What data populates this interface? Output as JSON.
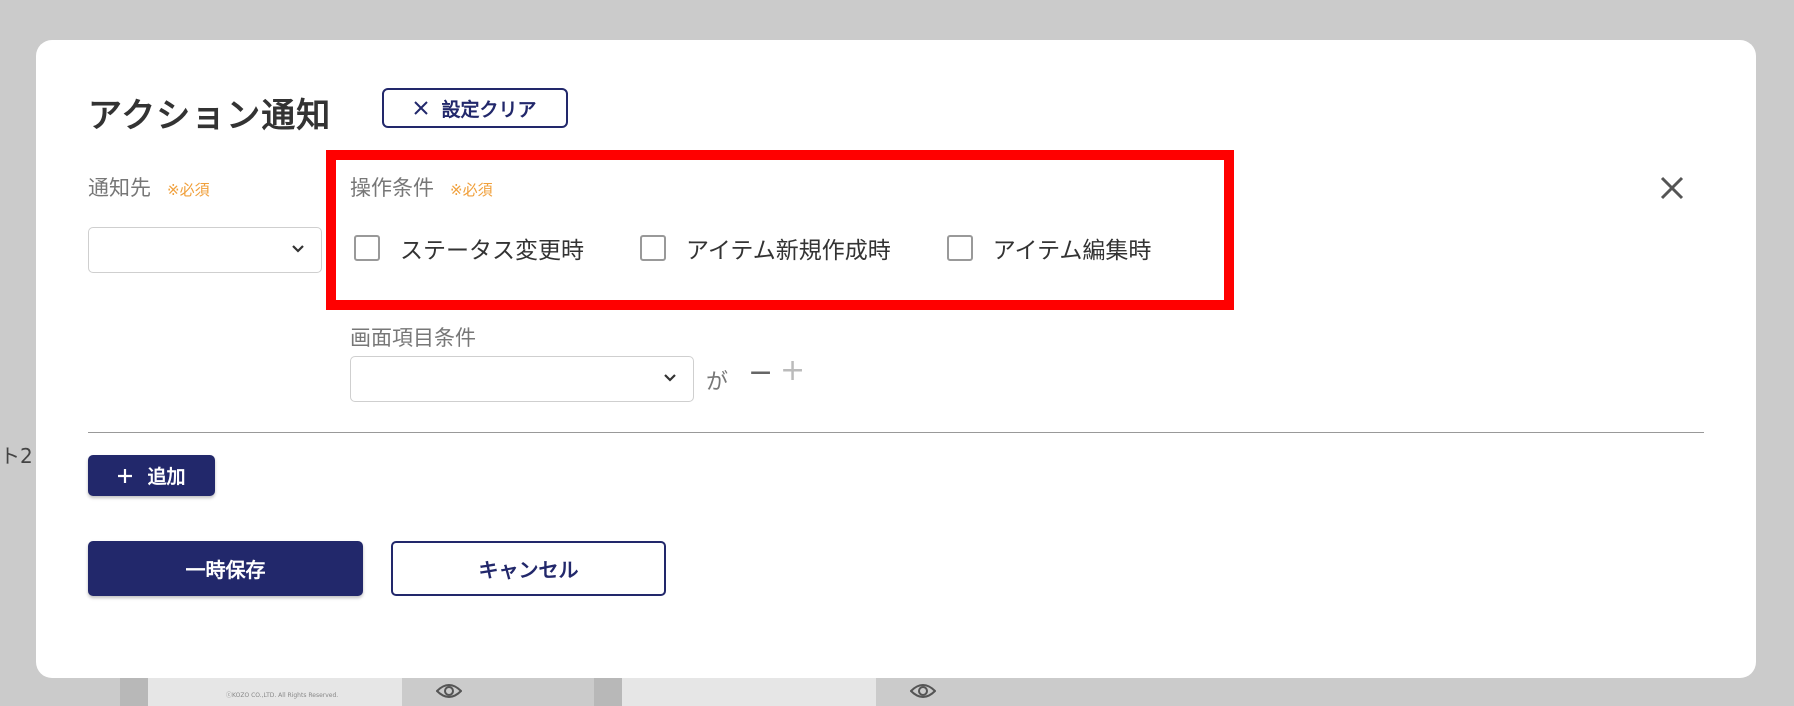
{
  "background": {
    "side_text": "ト2",
    "thumb_caption_1": "ⓒKOZO CO.,LTD. All Rights Reserved.",
    "icons": [
      "eye-icon",
      "eye-icon"
    ]
  },
  "modal": {
    "title": "アクション通知",
    "clear_button": {
      "label": "設定クリア",
      "icon": "x-icon"
    },
    "close_icon": "close-icon",
    "recipient": {
      "label": "通知先",
      "required": "※必須",
      "value": ""
    },
    "operation_condition": {
      "label": "操作条件",
      "required": "※必須",
      "options": [
        {
          "label": "ステータス変更時",
          "checked": false
        },
        {
          "label": "アイテム新規作成時",
          "checked": false
        },
        {
          "label": "アイテム編集時",
          "checked": false
        }
      ]
    },
    "screen_item_condition": {
      "label": "画面項目条件",
      "value": "",
      "connector": "が",
      "minus": "−",
      "plus": "+"
    },
    "add_button": {
      "label": "追加",
      "icon": "plus-icon"
    },
    "save_button": "一時保存",
    "cancel_button": "キャンセル"
  },
  "colors": {
    "primary": "#22286b",
    "required": "#f0a03c",
    "highlight": "#ff0000",
    "overlay": "#cbcbcb"
  }
}
